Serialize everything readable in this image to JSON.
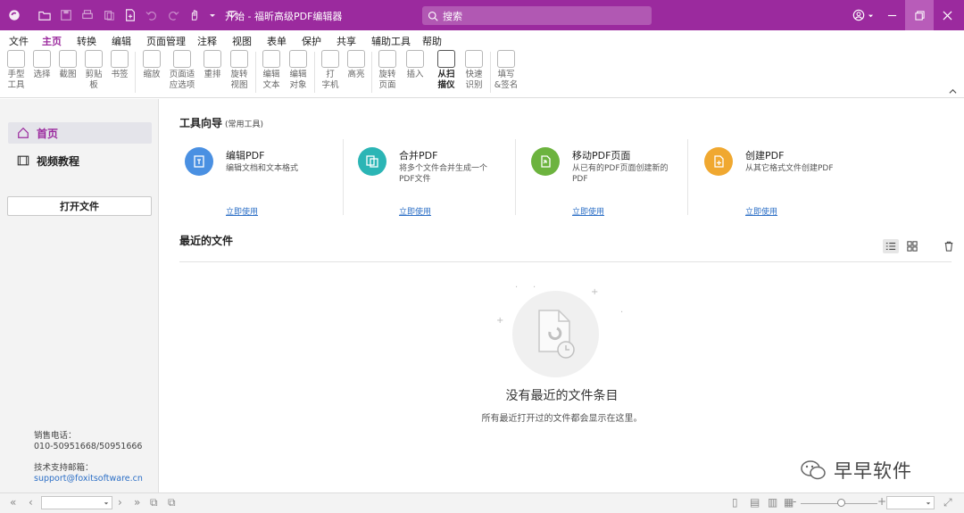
{
  "app": {
    "title": "开始 - 福昕高级PDF编辑器",
    "search_placeholder": "搜索",
    "brand_color": "#9b2a9e"
  },
  "menu": [
    {
      "label": "文件"
    },
    {
      "label": "主页"
    },
    {
      "label": "转换"
    },
    {
      "label": "编辑"
    },
    {
      "label": "页面管理"
    },
    {
      "label": "注释"
    },
    {
      "label": "视图"
    },
    {
      "label": "表单"
    },
    {
      "label": "保护"
    },
    {
      "label": "共享"
    },
    {
      "label": "辅助工具"
    },
    {
      "label": "帮助"
    }
  ],
  "ribbon": [
    {
      "label": "手型\n工具",
      "icon": "hand-icon"
    },
    {
      "label": "选择",
      "icon": "select-icon"
    },
    {
      "label": "截图",
      "icon": "snapshot-icon"
    },
    {
      "label": "剪贴\n板",
      "icon": "clipboard-icon"
    },
    {
      "label": "书签",
      "icon": "bookmark-icon"
    },
    {
      "label": "缩放",
      "icon": "zoom-icon"
    },
    {
      "label": "页面适\n应选项",
      "icon": "fit-page-icon"
    },
    {
      "label": "重排",
      "icon": "reflow-icon"
    },
    {
      "label": "旋转\n视图",
      "icon": "rotate-view-icon"
    },
    {
      "label": "编辑\n文本",
      "icon": "edit-text-icon"
    },
    {
      "label": "编辑\n对象",
      "icon": "edit-object-icon"
    },
    {
      "label": "打\n字机",
      "icon": "typewriter-icon"
    },
    {
      "label": "高亮",
      "icon": "highlight-icon"
    },
    {
      "label": "旋转\n页面",
      "icon": "rotate-page-icon"
    },
    {
      "label": "插入",
      "icon": "insert-icon"
    },
    {
      "label": "从扫\n描仪",
      "icon": "scanner-icon"
    },
    {
      "label": "快速\n识别",
      "icon": "ocr-icon"
    },
    {
      "label": "填写\n&签名",
      "icon": "fill-sign-icon"
    }
  ],
  "sidebar": {
    "items": [
      {
        "label": "首页",
        "icon": "home-icon"
      },
      {
        "label": "视频教程",
        "icon": "video-icon"
      }
    ],
    "open_file": "打开文件",
    "sales_label": "销售电话：",
    "sales_phone": "010-50951668/50951666",
    "support_label": "技术支持邮箱：",
    "support_email": "support@foxitsoftware.cn"
  },
  "main": {
    "tools_title": "工具向导",
    "tools_subtitle": "(常用工具)",
    "tools": [
      {
        "name": "编辑PDF",
        "desc": "编辑文档和文本格式",
        "use": "立即使用",
        "color": "#4a90e2",
        "icon": "edit-pdf-icon"
      },
      {
        "name": "合并PDF",
        "desc": "将多个文件合并生成一个PDF文件",
        "use": "立即使用",
        "color": "#2bb5b5",
        "icon": "merge-pdf-icon"
      },
      {
        "name": "移动PDF页面",
        "desc": "从已有的PDF页面创建新的PDF",
        "use": "立即使用",
        "color": "#6cb33e",
        "icon": "move-pages-icon"
      },
      {
        "name": "创建PDF",
        "desc": "从其它格式文件创建PDF",
        "use": "立即使用",
        "color": "#f0a830",
        "icon": "create-pdf-icon"
      }
    ],
    "recent_title": "最近的文件",
    "empty_title": "没有最近的文件条目",
    "empty_desc": "所有最近打开过的文件都会显示在这里。"
  },
  "watermark": "早早软件"
}
